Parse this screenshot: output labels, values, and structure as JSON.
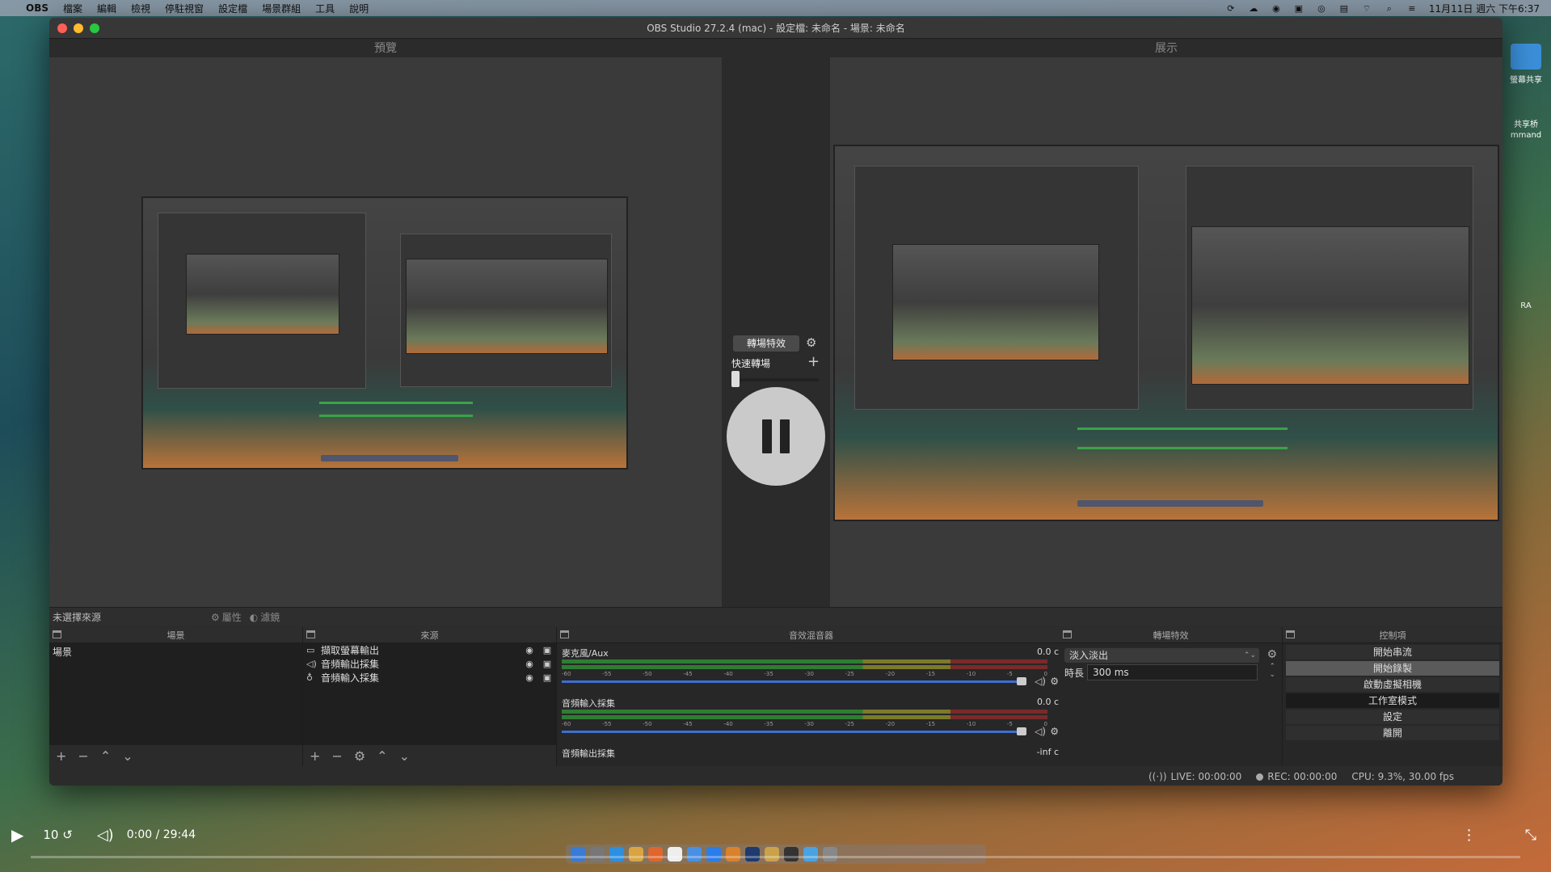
{
  "menubar": {
    "app_name": "OBS",
    "items": [
      "檔案",
      "編輯",
      "檢視",
      "停駐視窗",
      "設定檔",
      "場景群組",
      "工具",
      "說明"
    ],
    "clock": "11月11日 週六 下午6:37"
  },
  "window": {
    "title": "OBS Studio 27.2.4 (mac) - 設定檔: 未命名 - 場景: 未命名"
  },
  "panes": {
    "preview_label": "預覽",
    "program_label": "展示"
  },
  "transition": {
    "button_label": "轉場特效",
    "quick_label": "快速轉場"
  },
  "source_toolbar": {
    "no_source": "未選擇來源",
    "properties": "屬性",
    "filters": "濾鏡"
  },
  "docks": {
    "scenes": {
      "title": "場景",
      "items": [
        "場景"
      ]
    },
    "sources": {
      "title": "來源",
      "items": [
        {
          "icon": "monitor-icon",
          "name": "擷取螢幕輸出"
        },
        {
          "icon": "speaker-icon",
          "name": "音頻輸出採集"
        },
        {
          "icon": "microphone-icon",
          "name": "音頻輸入採集"
        }
      ]
    },
    "mixer": {
      "title": "音效混音器",
      "tracks": [
        {
          "name": "麥克風/Aux",
          "db": "0.0 c",
          "level": 1.0
        },
        {
          "name": "音頻輸入採集",
          "db": "0.0 c",
          "level": 1.0
        },
        {
          "name": "音頻輸出採集",
          "db": "-inf c",
          "level": 0.0
        }
      ],
      "ticks": [
        "-60",
        "-55",
        "-50",
        "-45",
        "-40",
        "-35",
        "-30",
        "-25",
        "-20",
        "-15",
        "-10",
        "-5",
        "0"
      ]
    },
    "transitions": {
      "title": "轉場特效",
      "selected": "淡入淡出",
      "duration_label": "時長",
      "duration_value": "300 ms"
    },
    "controls": {
      "title": "控制項",
      "buttons": [
        "開始串流",
        "開始錄製",
        "啟動虛擬相機",
        "工作室模式",
        "設定",
        "離開"
      ]
    }
  },
  "status": {
    "live": "LIVE: 00:00:00",
    "rec": "REC: 00:00:00",
    "cpu": "CPU: 9.3%, 30.00 fps"
  },
  "desktop": {
    "labels": [
      "螢幕共享",
      "共享桥",
      "mmand",
      "RA"
    ]
  },
  "video_player": {
    "skip_label": "10",
    "time": "0:00 / 29:44",
    "progress": 0.0
  }
}
